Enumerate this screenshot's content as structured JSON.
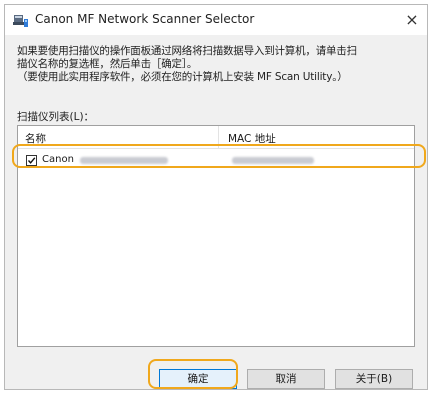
{
  "window": {
    "title": "Canon MF Network Scanner Selector",
    "close_glyph": "×"
  },
  "description": {
    "line1": "如果要使用扫描仪的操作面板通过网络将扫描数据导入到计算机，请单击扫",
    "line2": "描仪名称的复选框，然后单击［确定］。",
    "line3": "（要使用此实用程序软件，必须在您的计算机上安装 MF Scan Utility。）"
  },
  "scanner_list": {
    "label": "扫描仪列表(L)：",
    "columns": [
      "名称",
      "MAC 地址"
    ],
    "rows": [
      {
        "checked": true,
        "name": "Canon"
      }
    ]
  },
  "buttons": {
    "ok": "确定",
    "cancel": "取消",
    "about": "关于(B)"
  },
  "colors": {
    "highlight": "#f0a81c",
    "dialog_bg": "#f0f0f0"
  },
  "icons": {
    "app": "scanner-network-icon",
    "check": "check-icon",
    "close": "close-icon"
  }
}
